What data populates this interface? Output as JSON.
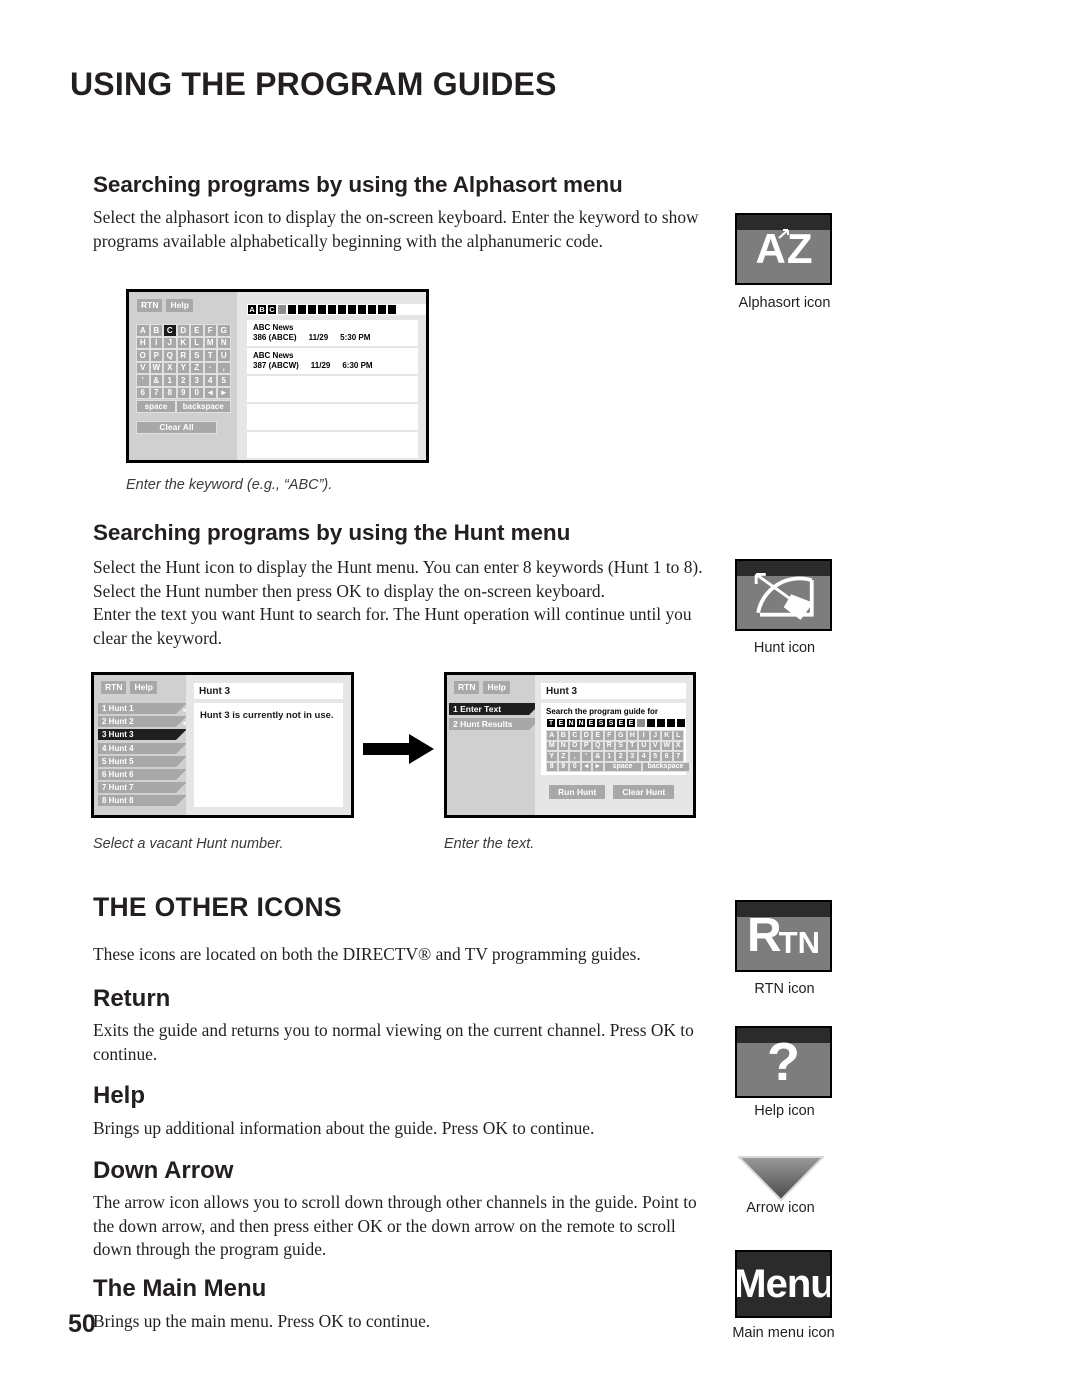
{
  "page": {
    "chapter_title": "USING THE PROGRAM GUIDES",
    "page_number": "50"
  },
  "sections": {
    "alphasort": {
      "heading": "Searching programs by using the Alphasort menu",
      "body": "Select the alphasort icon to display the on-screen keyboard. Enter the keyword to show programs available alphabetically beginning with the alphanumeric code.",
      "caption": "Enter the keyword (e.g., “ABC”)."
    },
    "hunt": {
      "heading": "Searching programs by using the Hunt menu",
      "body_line1": "Select the Hunt icon to display the Hunt menu. You can enter 8 keywords (Hunt 1 to 8).",
      "body_line2": "Select the Hunt number then press OK to display the on-screen keyboard.",
      "body_line3": "Enter the text you want Hunt to search for. The Hunt operation will continue until you",
      "body_line4": "clear the keyword.",
      "caption_left": "Select a vacant Hunt number.",
      "caption_right": "Enter the text."
    },
    "other_icons": {
      "heading": "THE OTHER ICONS",
      "body": "These icons are located on both the DIRECTV® and TV programming guides.",
      "items": [
        {
          "heading": "Return",
          "body": "Exits the guide and returns you to normal viewing on the current channel. Press OK to continue."
        },
        {
          "heading": "Help",
          "body": "Brings up additional information about the guide. Press OK to continue."
        },
        {
          "heading": "Down Arrow",
          "body": "The arrow icon allows you to scroll down through other channels in the guide. Point to the down arrow, and then press either OK or the down arrow on the remote to scroll down through the program guide."
        },
        {
          "heading": "The Main Menu",
          "body": "Brings up the main menu. Press OK to continue."
        }
      ]
    }
  },
  "icons": [
    {
      "name": "alphasort-icon",
      "glyph": "A‧Z",
      "caption": "Alphasort icon"
    },
    {
      "name": "hunt-icon",
      "glyph": "bow-and-arrow",
      "caption": "Hunt icon"
    },
    {
      "name": "rtn-icon",
      "glyph": "RTN",
      "caption": "RTN icon"
    },
    {
      "name": "help-icon",
      "glyph": "?",
      "caption": "Help icon"
    },
    {
      "name": "down-arrow-icon",
      "glyph": "▼",
      "caption": "Arrow icon"
    },
    {
      "name": "main-menu-icon",
      "glyph": "Menu",
      "caption": "Main menu icon"
    }
  ],
  "alphasort_screen": {
    "rtn_label": "RTN",
    "help_label": "Help",
    "keyboard_rows": [
      [
        "A",
        "B",
        "C",
        "D",
        "E",
        "F",
        "G"
      ],
      [
        "H",
        "I",
        "J",
        "K",
        "L",
        "M",
        "N"
      ],
      [
        "O",
        "P",
        "Q",
        "R",
        "S",
        "T",
        "U"
      ],
      [
        "V",
        "W",
        "X",
        "Y",
        "Z",
        "·",
        ","
      ],
      [
        "'",
        "&",
        "1",
        "2",
        "3",
        "4",
        "5"
      ],
      [
        "6",
        "7",
        "8",
        "9",
        "0",
        "◄",
        "►"
      ]
    ],
    "selected_key": "C",
    "space_label": "space",
    "backspace_label": "backspace",
    "clear_all_label": "Clear All",
    "entered_text": "ABC",
    "empty_slots": 11,
    "results": [
      {
        "title": "ABC News",
        "channel": "386 (ABCE)",
        "date": "11/29",
        "time": "5:30 PM"
      },
      {
        "title": "ABC News",
        "channel": "387 (ABCW)",
        "date": "11/29",
        "time": "6:30 PM"
      }
    ],
    "blank_rows": 3
  },
  "hunt_screen_left": {
    "rtn_label": "RTN",
    "help_label": "Help",
    "items": [
      {
        "label": "1 Hunt 1",
        "checked": true,
        "selected": false
      },
      {
        "label": "2 Hunt 2",
        "checked": true,
        "selected": false
      },
      {
        "label": "3 Hunt 3",
        "checked": false,
        "selected": true
      },
      {
        "label": "4 Hunt 4",
        "checked": false,
        "selected": false
      },
      {
        "label": "5 Hunt 5",
        "checked": false,
        "selected": false
      },
      {
        "label": "6 Hunt 6",
        "checked": false,
        "selected": false
      },
      {
        "label": "7 Hunt 7",
        "checked": false,
        "selected": false
      },
      {
        "label": "8 Hunt 8",
        "checked": false,
        "selected": false
      }
    ],
    "title": "Hunt 3",
    "message": "Hunt 3 is currently not in use."
  },
  "hunt_screen_right": {
    "rtn_label": "RTN",
    "help_label": "Help",
    "items": [
      {
        "label": "1 Enter Text",
        "selected": true
      },
      {
        "label": "2 Hunt Results",
        "selected": false
      }
    ],
    "title": "Hunt 3",
    "prompt": "Search the program guide for",
    "entered_text": "TENNESSEE",
    "empty_slots": 4,
    "keyboard_rows": [
      [
        "A",
        "B",
        "C",
        "D",
        "E",
        "F",
        "G",
        "H",
        "I",
        "J",
        "K",
        "L"
      ],
      [
        "M",
        "N",
        "O",
        "P",
        "Q",
        "R",
        "S",
        "T",
        "U",
        "V",
        "W",
        "X"
      ],
      [
        "Y",
        "Z",
        ",",
        "'",
        "&",
        "1",
        "2",
        "3",
        "4",
        "5",
        "6",
        "7"
      ],
      [
        "8",
        "9",
        "0",
        "◄",
        "►"
      ]
    ],
    "space_label": "space",
    "backspace_label": "backspace",
    "run_hunt_label": "Run Hunt",
    "clear_hunt_label": "Clear Hunt"
  },
  "colors": {
    "ink": "#231f20",
    "screen_gray": "#d0d0d0",
    "key_gray": "#a8a8a8",
    "selected_black": "#1a1a1a",
    "icon_gray": "#7d7d7d"
  }
}
